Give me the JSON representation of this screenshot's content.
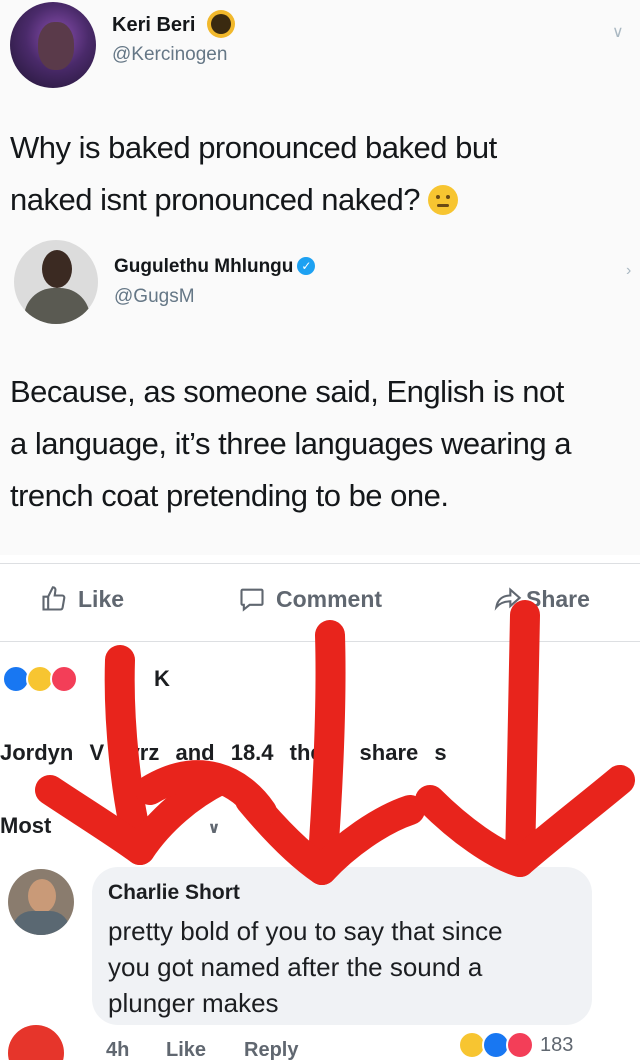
{
  "tweet": {
    "author1": {
      "name": "Keri Beri",
      "handle": "@Kercinogen"
    },
    "text1_line1": "Why is baked pronounced baked but",
    "text1_line2": "naked isnt pronounced naked?",
    "author2": {
      "name": "Gugulethu Mhlungu",
      "handle": "@GugsM"
    },
    "text2_line1": "Because, as someone said, English is not",
    "text2_line2": "a language, it’s three languages wearing a",
    "text2_line3": "trench coat pretending to be one."
  },
  "post_actions": {
    "like": "Like",
    "comment": "Comment",
    "share": "Share"
  },
  "reactions": {
    "icons": [
      "like-icon",
      "haha-icon",
      "love-icon"
    ],
    "count": "K"
  },
  "shares_text": "Jordyn V tyrz and 18.4 thers share s",
  "sort_label": "Most",
  "comment": {
    "author": "Charlie Short",
    "line1": "pretty bold of you to say that since",
    "line2": "you got named after the sound a",
    "line3": "plunger makes",
    "time": "4h",
    "like": "Like",
    "reply": "Reply",
    "reaction_count": "183"
  },
  "colors": {
    "fb_blue": "#1877f2",
    "twitter_blue": "#1da1f2",
    "marker_red": "#e8241c"
  }
}
